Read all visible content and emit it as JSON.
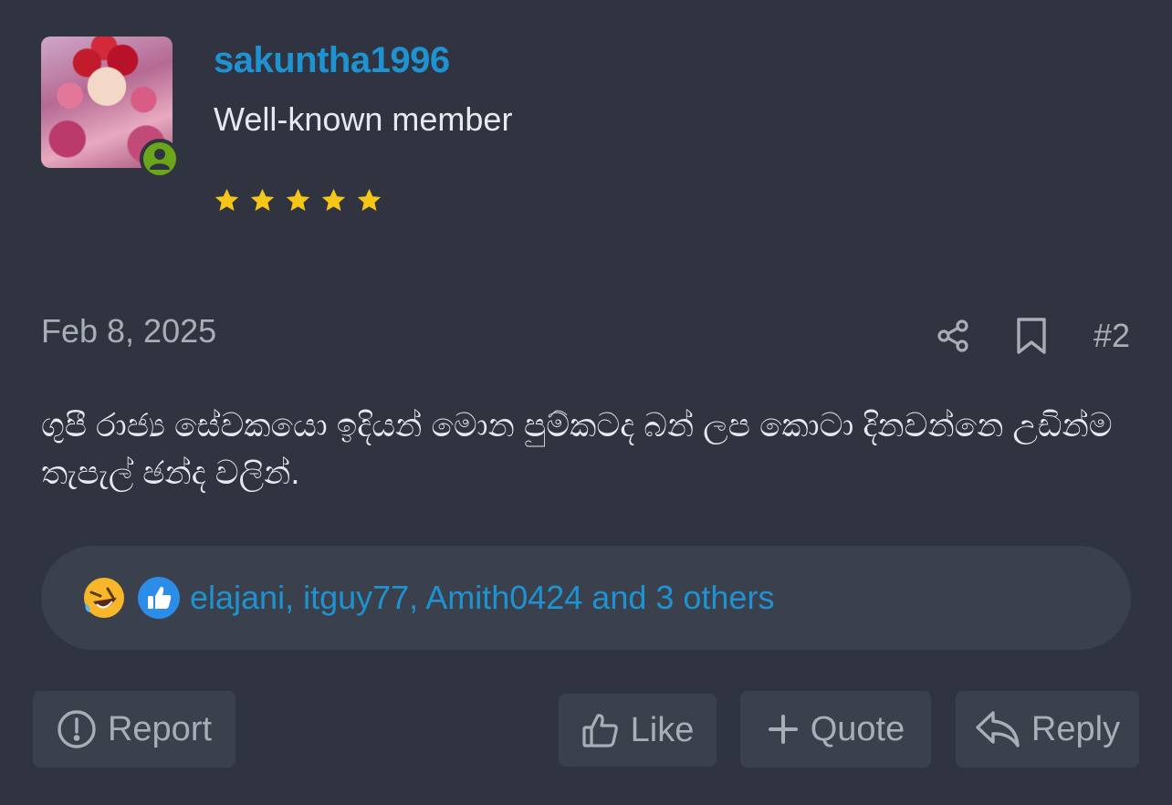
{
  "user": {
    "username": "sakuntha1996",
    "title": "Well-known member",
    "rating_stars": 5,
    "online": true
  },
  "post": {
    "date": "Feb 8, 2025",
    "number": "#2",
    "body": "ගුපී රාජ්‍ය සේවකයො ඉදියන් මොන පුම්කටද බන් ලප කොටා දිනවන්නෙ උඩින්ම තැපැල් ඡන්ද වලින්."
  },
  "reactions": {
    "icons": [
      "rolling-laughing-emoji",
      "thumbs-up-emoji"
    ],
    "text": "elajani, itguy77, Amith0424 and 3 others"
  },
  "actions": {
    "report": "Report",
    "like": "Like",
    "quote": "Quote",
    "reply": "Reply"
  },
  "colors": {
    "background": "#2f3440",
    "panel": "#3a404c",
    "link": "#1f93d2",
    "muted": "#a8adb8",
    "star": "#f5c518",
    "online": "#6aa51a"
  }
}
